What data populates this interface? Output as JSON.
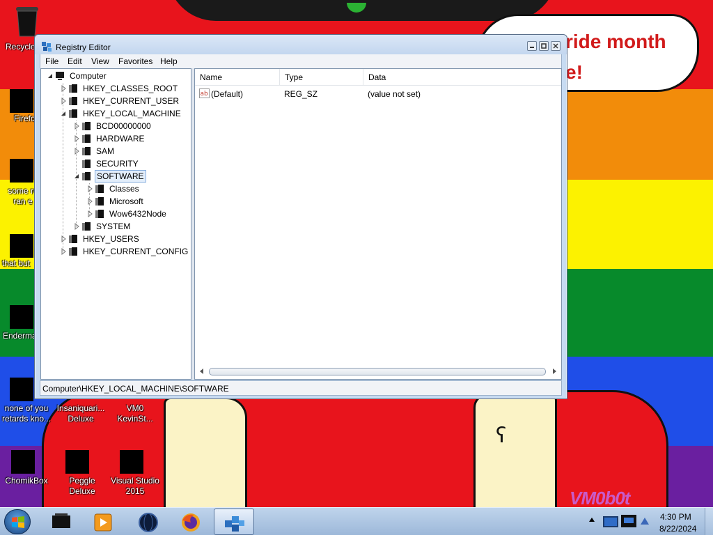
{
  "desktop": {
    "bubble_line1": "ride month",
    "bubble_line2": "e!",
    "watermark": "VM0b0t",
    "icons": [
      {
        "label": "Recycle"
      },
      {
        "label": "Firefo"
      },
      {
        "label": "some ru\nran e"
      },
      {
        "label": "that but"
      },
      {
        "label": "Enderma"
      },
      {
        "label": "none of you\nretards kno..."
      },
      {
        "label": "Insaniquari...\nDeluxe"
      },
      {
        "label": "VM0\nKevinSt..."
      },
      {
        "label": "ChomikBox"
      },
      {
        "label": "Peggle Deluxe"
      },
      {
        "label": "Visual Studio\n2015"
      }
    ]
  },
  "window": {
    "title": "Registry Editor",
    "menu": [
      "File",
      "Edit",
      "View",
      "Favorites",
      "Help"
    ],
    "tree": [
      {
        "label": "Computer"
      },
      {
        "label": "HKEY_CLASSES_ROOT"
      },
      {
        "label": "HKEY_CURRENT_USER"
      },
      {
        "label": "HKEY_LOCAL_MACHINE"
      },
      {
        "label": "BCD00000000"
      },
      {
        "label": "HARDWARE"
      },
      {
        "label": "SAM"
      },
      {
        "label": "SECURITY"
      },
      {
        "label": "SOFTWARE"
      },
      {
        "label": "Classes"
      },
      {
        "label": "Microsoft"
      },
      {
        "label": "Wow6432Node"
      },
      {
        "label": "SYSTEM"
      },
      {
        "label": "HKEY_USERS"
      },
      {
        "label": "HKEY_CURRENT_CONFIG"
      }
    ],
    "columns": [
      "Name",
      "Type",
      "Data"
    ],
    "values": [
      {
        "name": "(Default)",
        "type": "REG_SZ",
        "data": "(value not set)"
      }
    ],
    "status": "Computer\\HKEY_LOCAL_MACHINE\\SOFTWARE"
  },
  "taskbar": {
    "time": "4:30 PM",
    "date": "8/22/2024"
  }
}
